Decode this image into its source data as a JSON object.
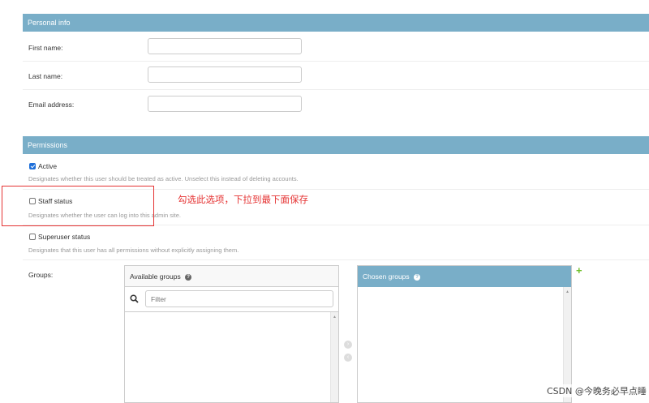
{
  "personal_info": {
    "header": "Personal info",
    "fields": [
      {
        "label": "First name:",
        "value": ""
      },
      {
        "label": "Last name:",
        "value": ""
      },
      {
        "label": "Email address:",
        "value": ""
      }
    ]
  },
  "permissions": {
    "header": "Permissions",
    "active": {
      "label": "Active",
      "checked": true,
      "help": "Designates whether this user should be treated as active. Unselect this instead of deleting accounts."
    },
    "staff": {
      "label": "Staff status",
      "checked": false,
      "help": "Designates whether the user can log into this admin site."
    },
    "superuser": {
      "label": "Superuser status",
      "checked": false,
      "help": "Designates that this user has all permissions without explicitly assigning them."
    }
  },
  "groups": {
    "label": "Groups:",
    "available_title": "Available groups",
    "filter_placeholder": "Filter",
    "chosen_title": "Chosen groups",
    "add_symbol": "+",
    "help_symbol": "?"
  },
  "annotation": {
    "text": "勾选此选项，下拉到最下面保存",
    "color": "#e53333"
  },
  "watermark": "CSDN @今晚务必早点睡",
  "colors": {
    "header_bg": "#79aec8",
    "add_green": "#70bf2b",
    "checkbox_blue": "#1e6fd9"
  }
}
